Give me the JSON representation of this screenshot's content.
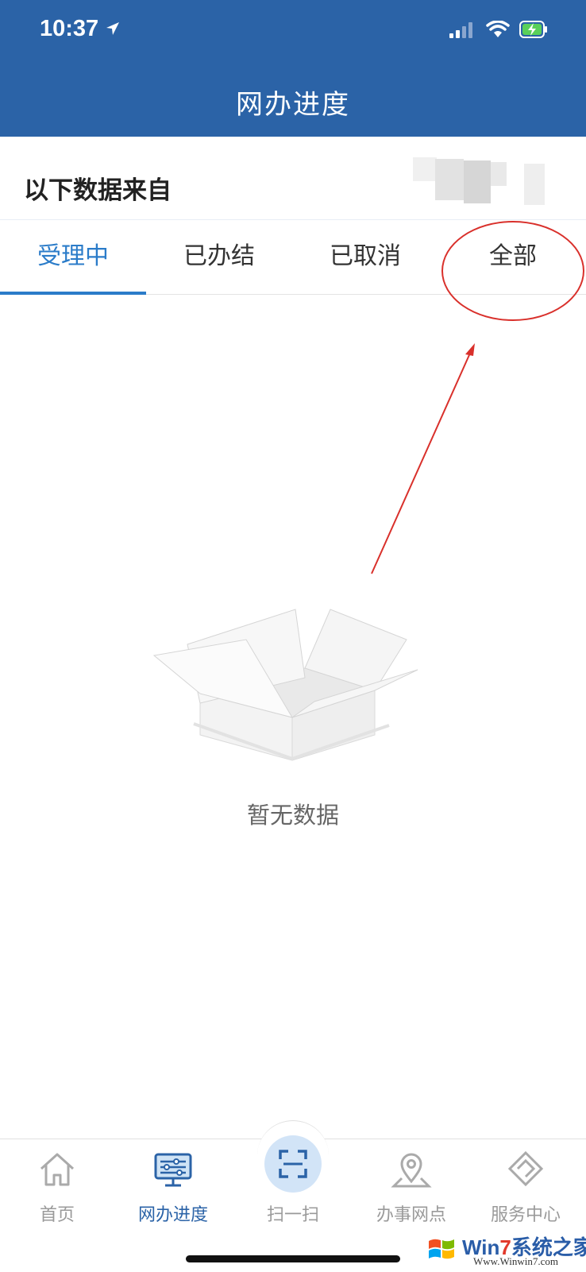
{
  "status_bar": {
    "time": "10:37"
  },
  "header": {
    "title": "网办进度"
  },
  "source": {
    "label": "以下数据来自"
  },
  "tabs": [
    {
      "label": "受理中",
      "active": true
    },
    {
      "label": "已办结",
      "active": false
    },
    {
      "label": "已取消",
      "active": false
    },
    {
      "label": "全部",
      "active": false
    }
  ],
  "empty_state": {
    "text": "暂无数据",
    "icon": "empty-box-icon"
  },
  "bottom_nav": {
    "items": [
      {
        "label": "首页",
        "icon": "home-icon",
        "active": false
      },
      {
        "label": "网办进度",
        "icon": "monitor-icon",
        "active": true
      },
      {
        "label": "扫一扫",
        "icon": "scan-icon",
        "active": false
      },
      {
        "label": "办事网点",
        "icon": "location-icon",
        "active": false
      },
      {
        "label": "服务中心",
        "icon": "handshake-icon",
        "active": false
      }
    ]
  },
  "watermark": {
    "title_a": "Win",
    "title_b": "7",
    "title_c": "系统之家",
    "url": "Www.Winwin7.com"
  },
  "colors": {
    "header_bg": "#2b63a7",
    "accent": "#2b7cc9",
    "annotation": "#d9302b"
  }
}
